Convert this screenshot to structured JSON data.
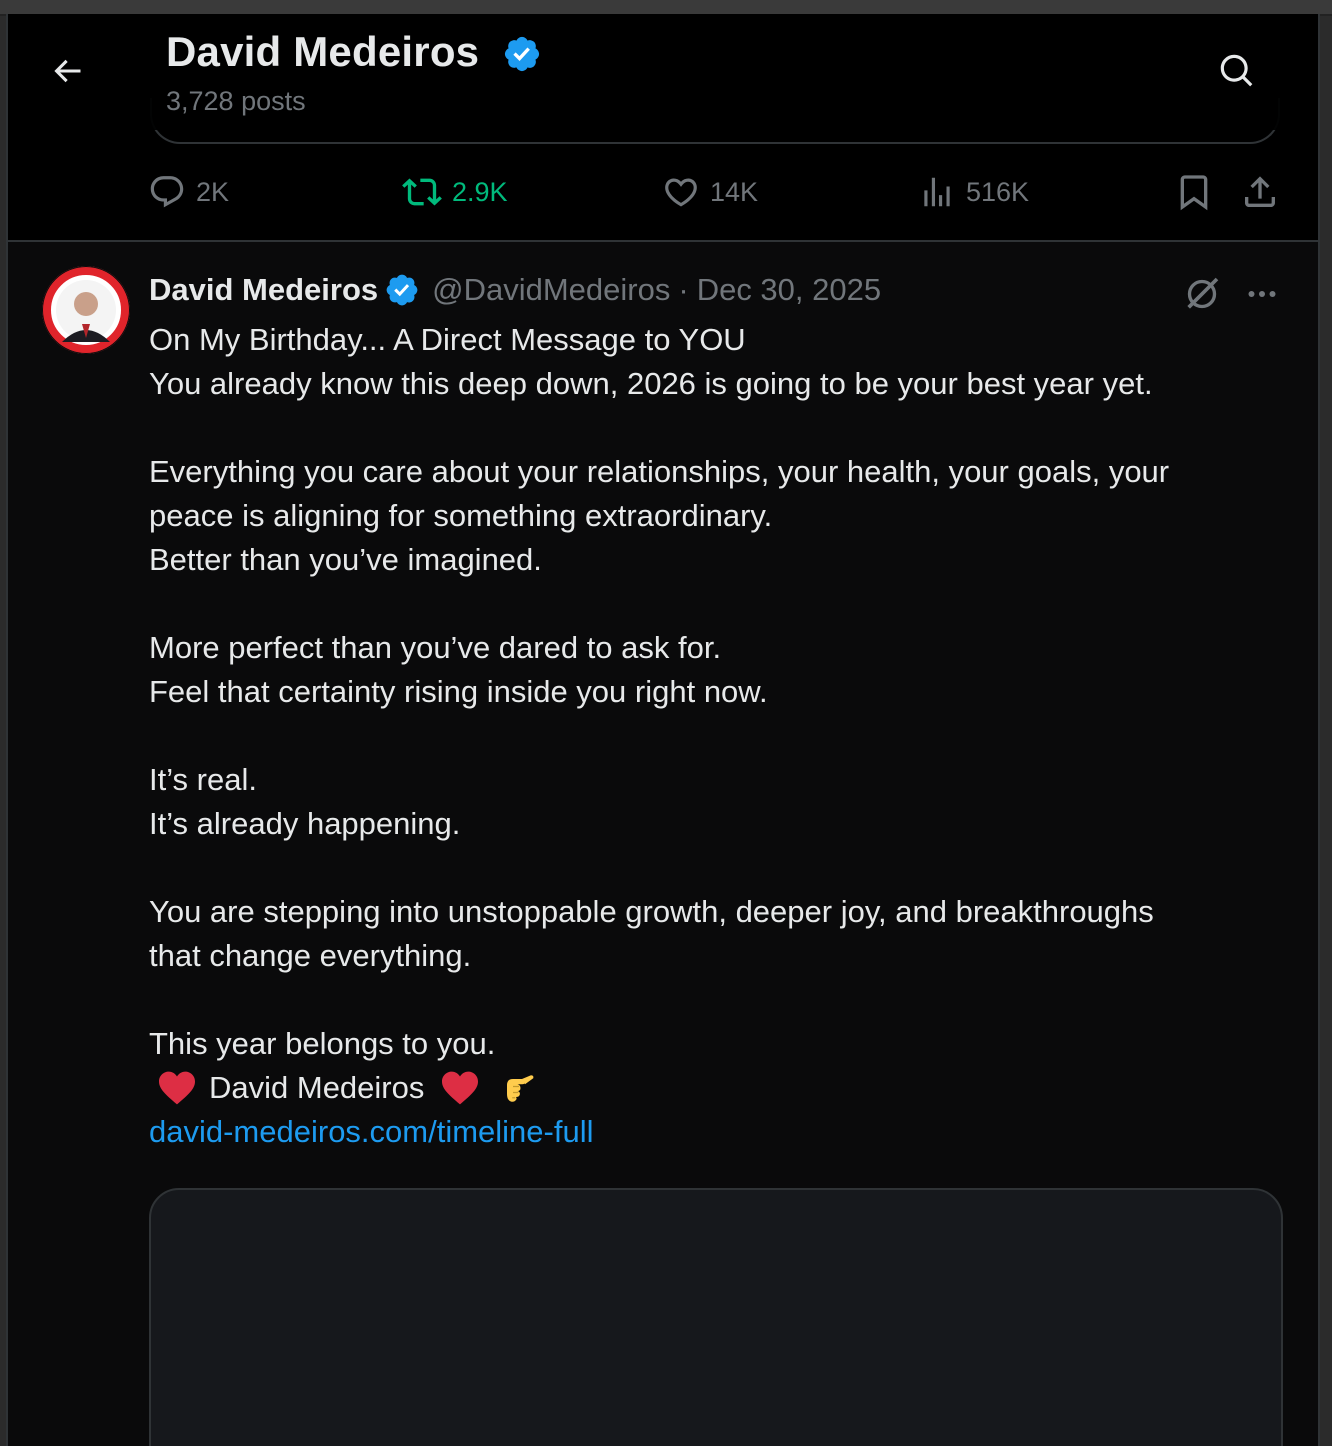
{
  "header": {
    "name": "David Medeiros",
    "posts_count": "3,728 posts",
    "back_icon": "arrow-left-icon",
    "search_icon": "search-icon"
  },
  "prev_post_actions": {
    "replies": "2K",
    "reposts": "2.9K",
    "likes": "14K",
    "views": "516K"
  },
  "post": {
    "author_name": "David Medeiros",
    "handle": "@DavidMedeiros",
    "separator": "·",
    "date": "Dec 30, 2025",
    "lines": [
      "On My Birthday... A Direct Message to YOU",
      "You already know this deep down, 2026 is going to be your best year yet.",
      "",
      "Everything you care about your relationships, your health, your goals, your",
      "peace is aligning for something extraordinary.",
      "Better than you’ve imagined.",
      "",
      "More perfect than you’ve dared to ask for.",
      "Feel that certainty rising inside you right now.",
      "",
      "It’s real.",
      "It’s already happening.",
      "",
      "You are stepping into unstoppable growth, deeper joy, and breakthroughs",
      "that change everything.",
      "",
      "This year belongs to you."
    ],
    "signature": "David Medeiros",
    "signature_emojis": [
      "red-heart",
      "red-heart",
      "pointing-hand"
    ],
    "link": "david-medeiros.com/timeline-full"
  },
  "colors": {
    "background": "#000000",
    "post_background": "#0a0a0b",
    "text": "#e7e9ea",
    "muted": "#71767b",
    "accent_blue": "#1d9bf0",
    "repost_green": "#00ba7c",
    "border": "#2f3336"
  }
}
